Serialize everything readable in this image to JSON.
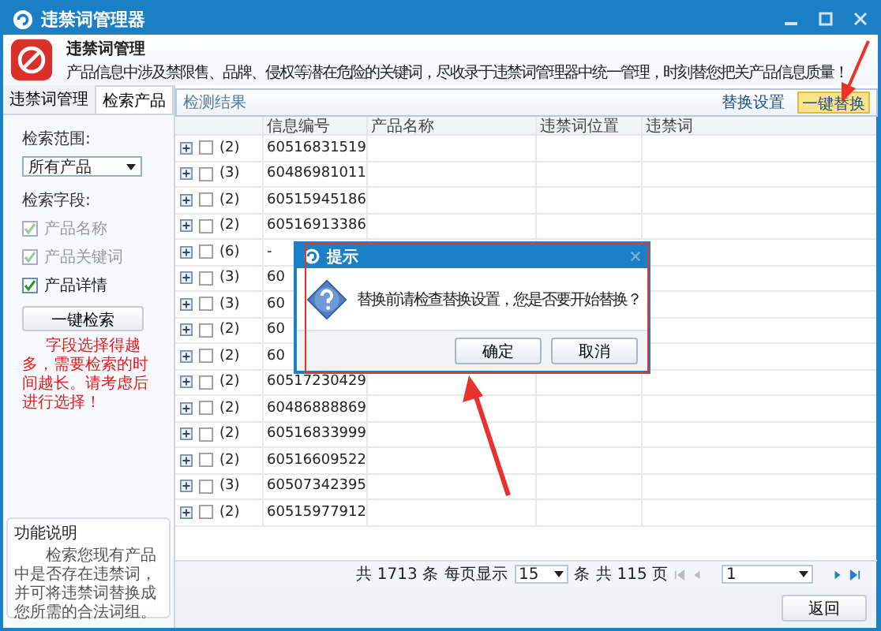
{
  "window": {
    "title": "违禁词管理器"
  },
  "header": {
    "title": "违禁词管理",
    "description": "产品信息中涉及禁限售、品牌、侵权等潜在危险的关键词，尽收录于违禁词管理器中统一管理，时刻替您把关产品信息质量！"
  },
  "tabs": [
    {
      "label": "违禁词管理",
      "selected": false
    },
    {
      "label": "检索产品",
      "selected": true
    }
  ],
  "search_panel": {
    "scope_label": "检索范围:",
    "scope_value": "所有产品",
    "fields_label": "检索字段:",
    "fields": [
      {
        "label": "产品名称",
        "checked": true,
        "disabled": true
      },
      {
        "label": "产品关键词",
        "checked": true,
        "disabled": true
      },
      {
        "label": "产品详情",
        "checked": true,
        "disabled": false
      }
    ],
    "search_button": "一键检索",
    "warning": "字段选择得越多，需要检索的时间越长。请考虑后进行选择！"
  },
  "help": {
    "title": "功能说明",
    "text": "检索您现有产品中是否存在违禁词，并可将违禁词替换成您所需的合法词组。"
  },
  "results": {
    "title": "检测结果",
    "actions": [
      {
        "label": "替换设置",
        "kind": "link"
      },
      {
        "label": "一键替换",
        "kind": "primary"
      }
    ]
  },
  "table": {
    "columns": [
      "信息编号",
      "产品名称",
      "违禁词位置",
      "违禁词"
    ],
    "rows": [
      {
        "count": "(2)",
        "id": "60516831519",
        "checked": false
      },
      {
        "count": "(3)",
        "id": "60486981011",
        "checked": false
      },
      {
        "count": "(2)",
        "id": "60515945186",
        "checked": false
      },
      {
        "count": "(2)",
        "id": "60516913386",
        "checked": false
      },
      {
        "count": "(6)",
        "id": "-",
        "checked": false
      },
      {
        "count": "(3)",
        "id": "60",
        "checked": false
      },
      {
        "count": "(3)",
        "id": "60",
        "checked": false
      },
      {
        "count": "(2)",
        "id": "60",
        "checked": false
      },
      {
        "count": "(2)",
        "id": "60",
        "checked": false
      },
      {
        "count": "(2)",
        "id": "60517230429",
        "checked": false
      },
      {
        "count": "(2)",
        "id": "60486888869",
        "checked": false
      },
      {
        "count": "(2)",
        "id": "60516833999",
        "checked": false
      },
      {
        "count": "(2)",
        "id": "60516609522",
        "checked": false
      },
      {
        "count": "(3)",
        "id": "60507342395",
        "checked": false
      },
      {
        "count": "(2)",
        "id": "60515977912",
        "checked": false
      }
    ]
  },
  "pagination": {
    "total": "共 1713 条",
    "per_page_label": "每页显示",
    "per_page": "15",
    "unit": "条",
    "pages": "共 115 页",
    "page": "1"
  },
  "back_button": "返回",
  "dialog": {
    "title": "提示",
    "message": "替换前请检查替换设置，您是否要开始替换？",
    "buttons": [
      "确定",
      "取消"
    ]
  }
}
